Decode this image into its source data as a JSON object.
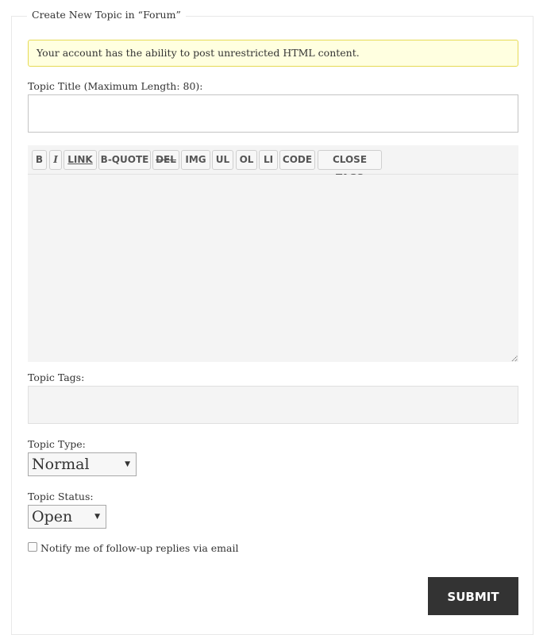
{
  "form": {
    "legend": "Create New Topic in “Forum”",
    "notice": "Your account has the ability to post unrestricted HTML content.",
    "title_label": "Topic Title (Maximum Length: 80):",
    "title_value": "",
    "toolbar": {
      "buttons": [
        {
          "label": "B",
          "name": "bold"
        },
        {
          "label": "I",
          "name": "italic"
        },
        {
          "label": "LINK",
          "name": "link"
        },
        {
          "label": "B-QUOTE",
          "name": "blockquote"
        },
        {
          "label": "DEL",
          "name": "del"
        },
        {
          "label": "IMG",
          "name": "img"
        },
        {
          "label": "UL",
          "name": "ul"
        },
        {
          "label": "OL",
          "name": "ol"
        },
        {
          "label": "LI",
          "name": "li"
        },
        {
          "label": "CODE",
          "name": "code"
        },
        {
          "label": "CLOSE TAGS",
          "name": "close-tags"
        }
      ]
    },
    "content_value": "",
    "tags_label": "Topic Tags:",
    "tags_value": "",
    "type_label": "Topic Type:",
    "type_selected": "Normal",
    "status_label": "Topic Status:",
    "status_selected": "Open",
    "dropdown_arrow": "▼",
    "notify_label": "Notify me of follow-up replies via email",
    "notify_checked": false,
    "submit_label": "SUBMIT"
  }
}
